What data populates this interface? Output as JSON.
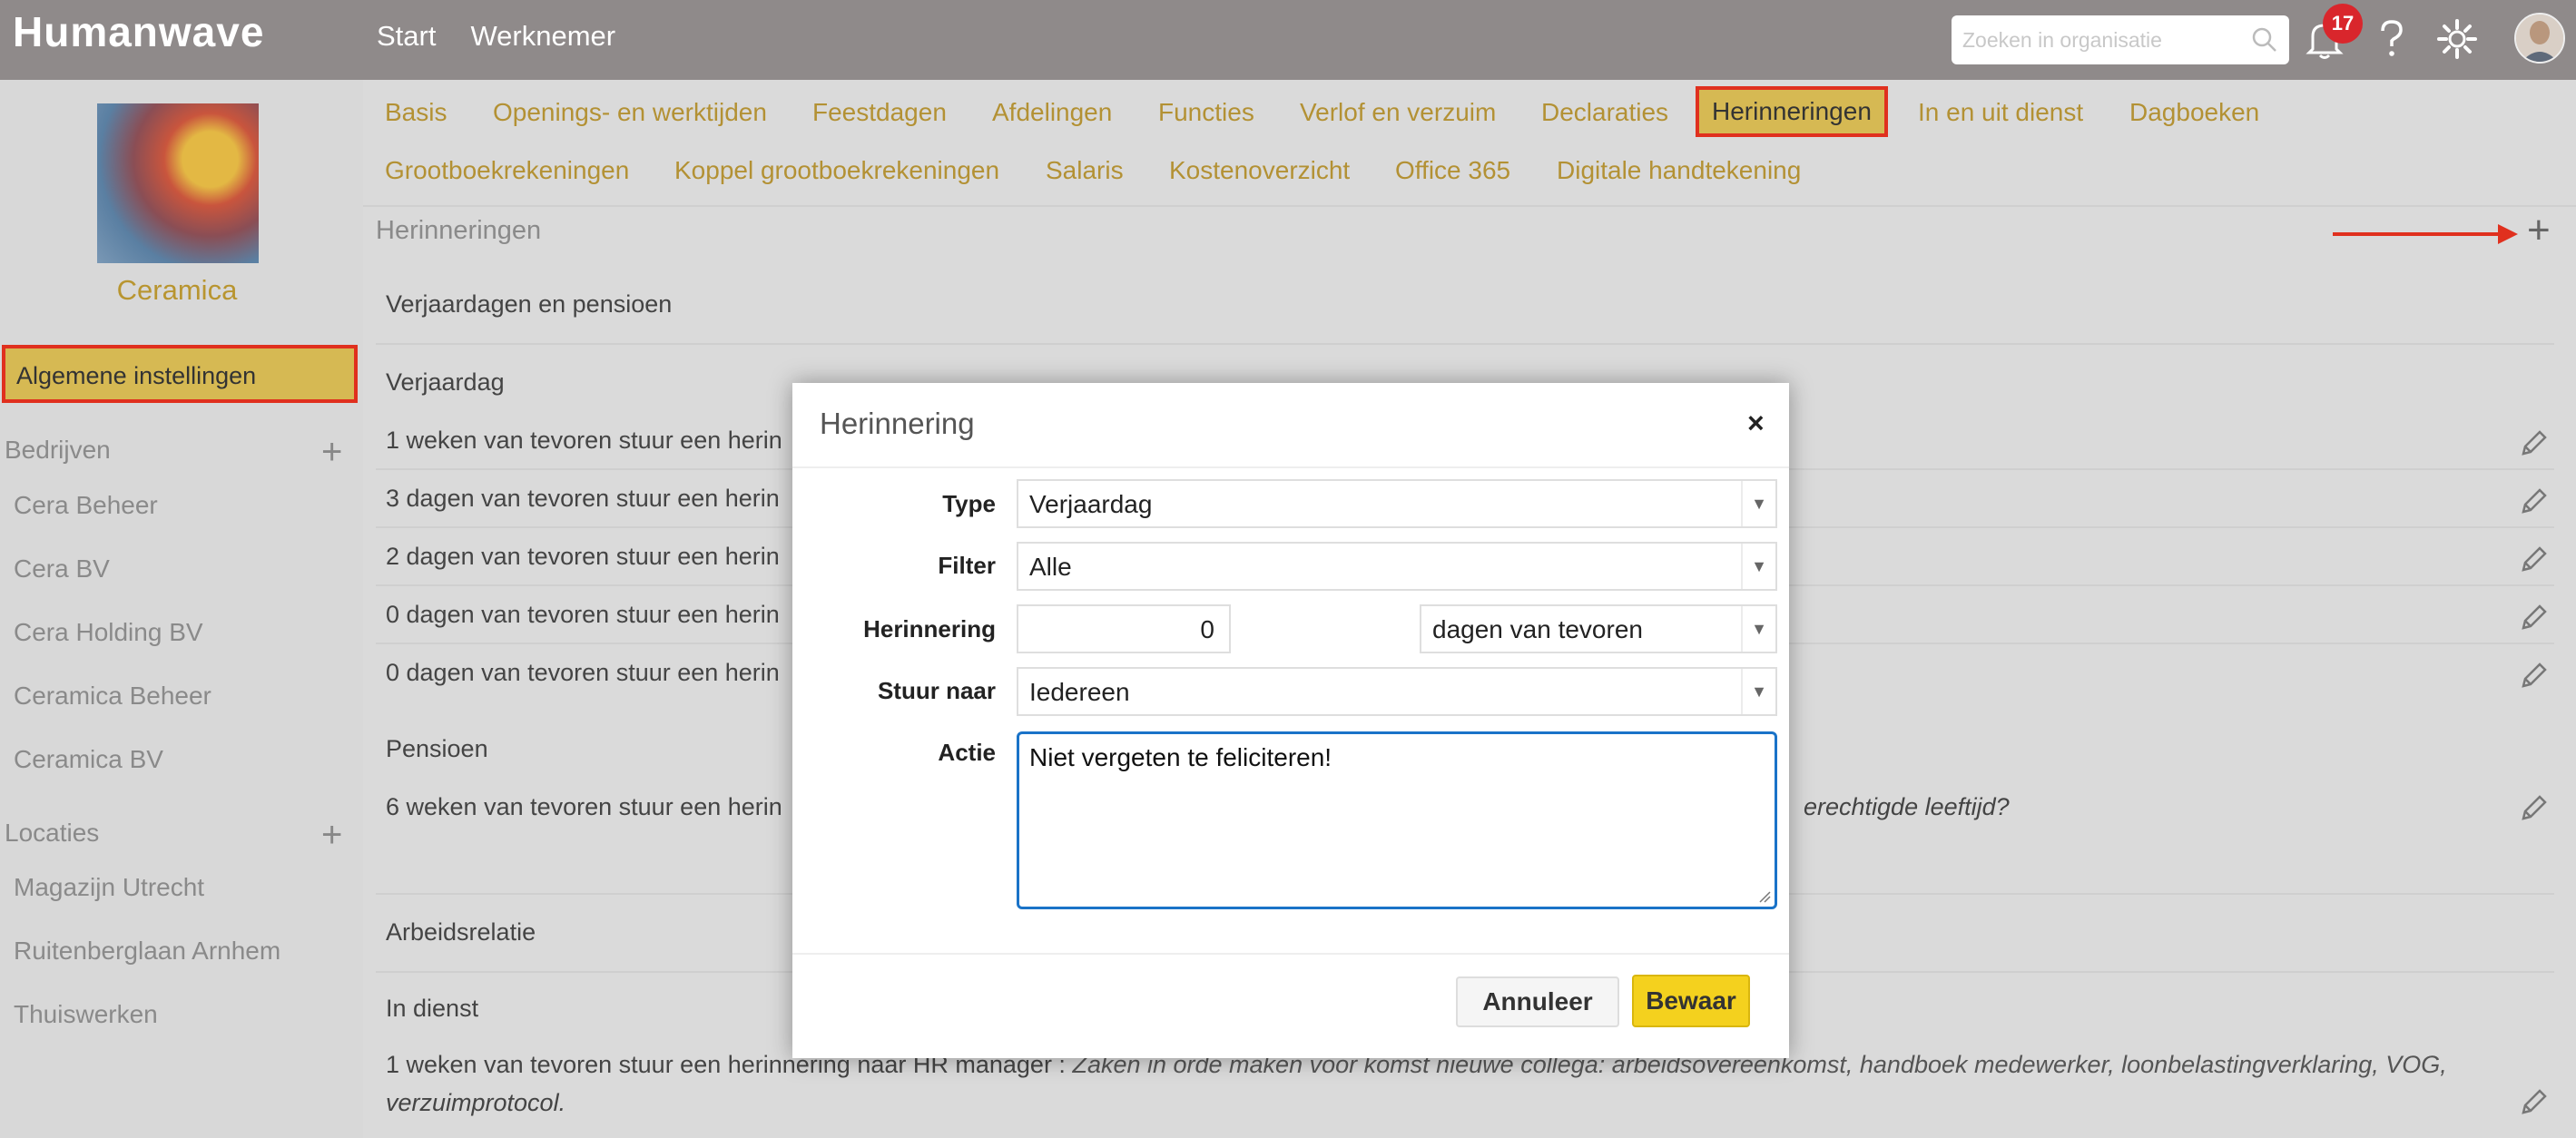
{
  "topbar": {
    "logo": "Humanwave",
    "nav": [
      "Start",
      "Werknemer"
    ],
    "search_placeholder": "Zoeken in organisatie",
    "notification_count": "17",
    "colors": {
      "bar": "#8f8a8a",
      "badge": "#d9262c"
    }
  },
  "sidebar": {
    "company_name": "Ceramica",
    "selected_item": "Algemene instellingen",
    "bedrijven_heading": "Bedrijven",
    "bedrijven": [
      "Cera Beheer",
      "Cera BV",
      "Cera Holding BV",
      "Ceramica Beheer",
      "Ceramica BV"
    ],
    "locaties_heading": "Locaties",
    "locaties": [
      "Magazijn Utrecht",
      "Ruitenberglaan Arnhem",
      "Thuiswerken"
    ]
  },
  "tabs": {
    "row1": [
      "Basis",
      "Openings- en werktijden",
      "Feestdagen",
      "Afdelingen",
      "Functies",
      "Verlof en verzuim",
      "Declaraties",
      "Herinneringen",
      "In en uit dienst",
      "Dagboeken"
    ],
    "row2": [
      "Grootboekrekeningen",
      "Koppel grootboekrekeningen",
      "Salaris",
      "Kostenoverzicht",
      "Office 365",
      "Digitale handtekening"
    ],
    "active": "Herinneringen"
  },
  "main": {
    "section_title": "Herinneringen",
    "group1_title": "Verjaardagen en pensioen",
    "verjaardag_title": "Verjaardag",
    "verjaardag_rows": [
      "1 weken van tevoren stuur een herin",
      "3 dagen van tevoren stuur een herin",
      "2 dagen van tevoren stuur een herin",
      "0 dagen van tevoren stuur een herin",
      "0 dagen van tevoren stuur een herin"
    ],
    "pensioen_title": "Pensioen",
    "pensioen_row": "6 weken van tevoren stuur een herin",
    "pensioen_row_tail": "erechtigde leeftijd?",
    "group2_title": "Arbeidsrelatie",
    "in_dienst_title": "In dienst",
    "in_dienst_row_prefix": "1 weken van tevoren stuur een herinnering naar HR manager :",
    "in_dienst_row_italic": "Zaken in orde maken voor komst nieuwe collega: arbeidsovereenkomst, handboek medewerker, loonbelastingverklaring, VOG,",
    "in_dienst_row_line2": "verzuimprotocol."
  },
  "modal": {
    "title": "Herinnering",
    "close": "×",
    "type_label": "Type",
    "type_value": "Verjaardag",
    "filter_label": "Filter",
    "filter_value": "Alle",
    "herinnering_label": "Herinnering",
    "herinnering_value": "0",
    "herinnering_unit": "dagen van tevoren",
    "stuur_naar_label": "Stuur naar",
    "stuur_naar_value": "Iedereen",
    "actie_label": "Actie",
    "actie_value": "Niet vergeten te feliciteren!",
    "cancel_label": "Annuleer",
    "save_label": "Bewaar"
  }
}
